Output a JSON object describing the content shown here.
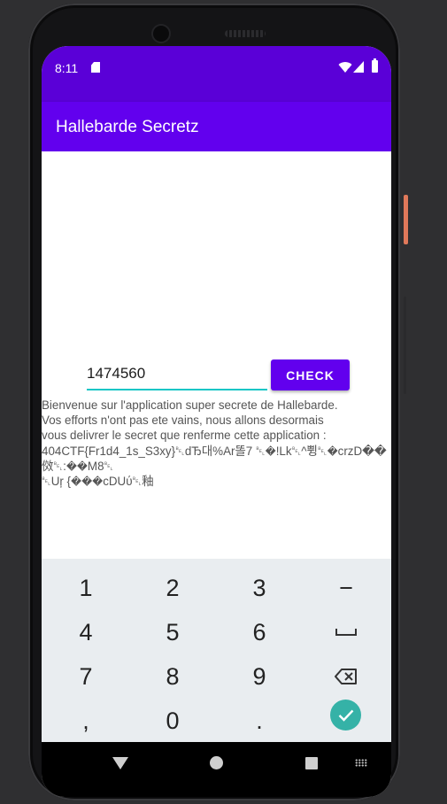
{
  "status_bar": {
    "time": "8:11",
    "icons": [
      "sd-card-icon",
      "wifi-icon",
      "signal-icon",
      "battery-icon"
    ]
  },
  "app_bar": {
    "title": "Hallebarde Secretz"
  },
  "form": {
    "code_value": "1474560",
    "check_label": "CHECK"
  },
  "message": {
    "line1": "Bienvenue sur l'application super secrete de Hallebarde.",
    "line2": "Vos efforts n'ont pas ete vains, nous allons desormais",
    "line3": "vous delivrer le secret que renferme cette application :",
    "line4": "404CTF{Fr1d4_1s_S3xy}␇dЂ대%Ar똘7 ␇�!Lk␇^쀵␇�crzD��",
    "line5": "傚␇:��M8␇",
    "line6": "␇Uŗ {���cDUύ␇釉"
  },
  "keyboard": {
    "keys": [
      "1",
      "2",
      "3",
      "−",
      "4",
      "5",
      "6",
      "space",
      "7",
      "8",
      "9",
      "backspace",
      ",",
      "0",
      ".",
      "done"
    ]
  },
  "colors": {
    "primary": "#6200ee",
    "primary_dark": "#5a00d7",
    "accent": "#14c6c6",
    "enter": "#35b2a7"
  }
}
